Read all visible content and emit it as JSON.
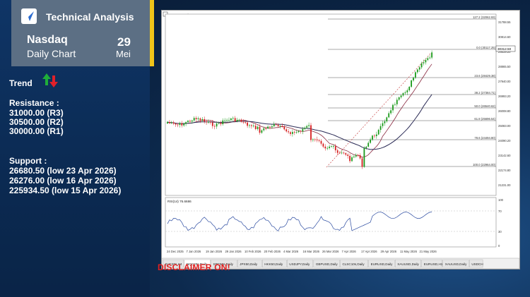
{
  "brand": "Technical Analysis",
  "market": "Nasdaq",
  "chart_type": "Daily Chart",
  "date_day": "29",
  "date_month": "Mei",
  "trend_label": "Trend",
  "resistance_title": "Resistance :",
  "resistance": [
    "31000.00 (R3)",
    "30500.00 (R2)",
    "30000.00 (R1)"
  ],
  "support_title": "Support :",
  "support": [
    "26680.50 (low 23 Apr 2026)",
    "26276.00 (low 16 Apr 2026)",
    "225934.50 (low 15 Apr 2026)"
  ],
  "chart_header": "NQC20s.Daily  30296.00 30325.25 30295.75 30312.50",
  "fib_labels": [
    "127.2 (32062.93)",
    "0.0 (30117.25)",
    "23.6 (28429.38)",
    "38.2 (27384.71)",
    "50.0 (26540.62)",
    "61.8 (25696.54)",
    "78.6 (24494.80)",
    "100.0 (22964.00)"
  ],
  "price_labels": [
    "31788.55",
    "30814.60",
    "29839.20",
    "28865.50",
    "27940.00",
    "26993.20",
    "26008.80",
    "25083.00",
    "24090.20",
    "23142.60",
    "22174.80",
    "21231.00"
  ],
  "current_price": "30312.50",
  "rsi_label": "RSI(14) 76.6686",
  "rsi_levels": [
    "100",
    "70",
    "30",
    "0"
  ],
  "x_labels": [
    "24 Dec 2025",
    "7 Jan 2026",
    "19 Jan 2026",
    "29 Jan 2026",
    "10 Feb 2026",
    "20 Feb 2026",
    "4 Mar 2026",
    "16 Mar 2026",
    "26 Mar 2026",
    "7 Apr 2026",
    "17 Apr 2026",
    "29 Apr 2026",
    "11 May 2026",
    "21 May 2026"
  ],
  "tabs": [
    "DJC20s,H4",
    "NQC20s,Daily",
    "SPC50s,Daily",
    "JPX50,Daily",
    "HKK50,Daily",
    "USDJPY,Daily",
    "GBPUSD,Daily",
    "CLSC10s,Daily",
    "EURUSD,Daily",
    "XAUUSD,Daily",
    "EURUSD,H1",
    "XAUUSD,Daily",
    "USDCH"
  ],
  "disclaimer": "DISCLAIMER ON!",
  "colors": {
    "accent": "#f0c419",
    "header_bg": "#5c6f84",
    "up": "#1a9a1a",
    "down": "#d62020",
    "disclaimer": "#e02020"
  }
}
